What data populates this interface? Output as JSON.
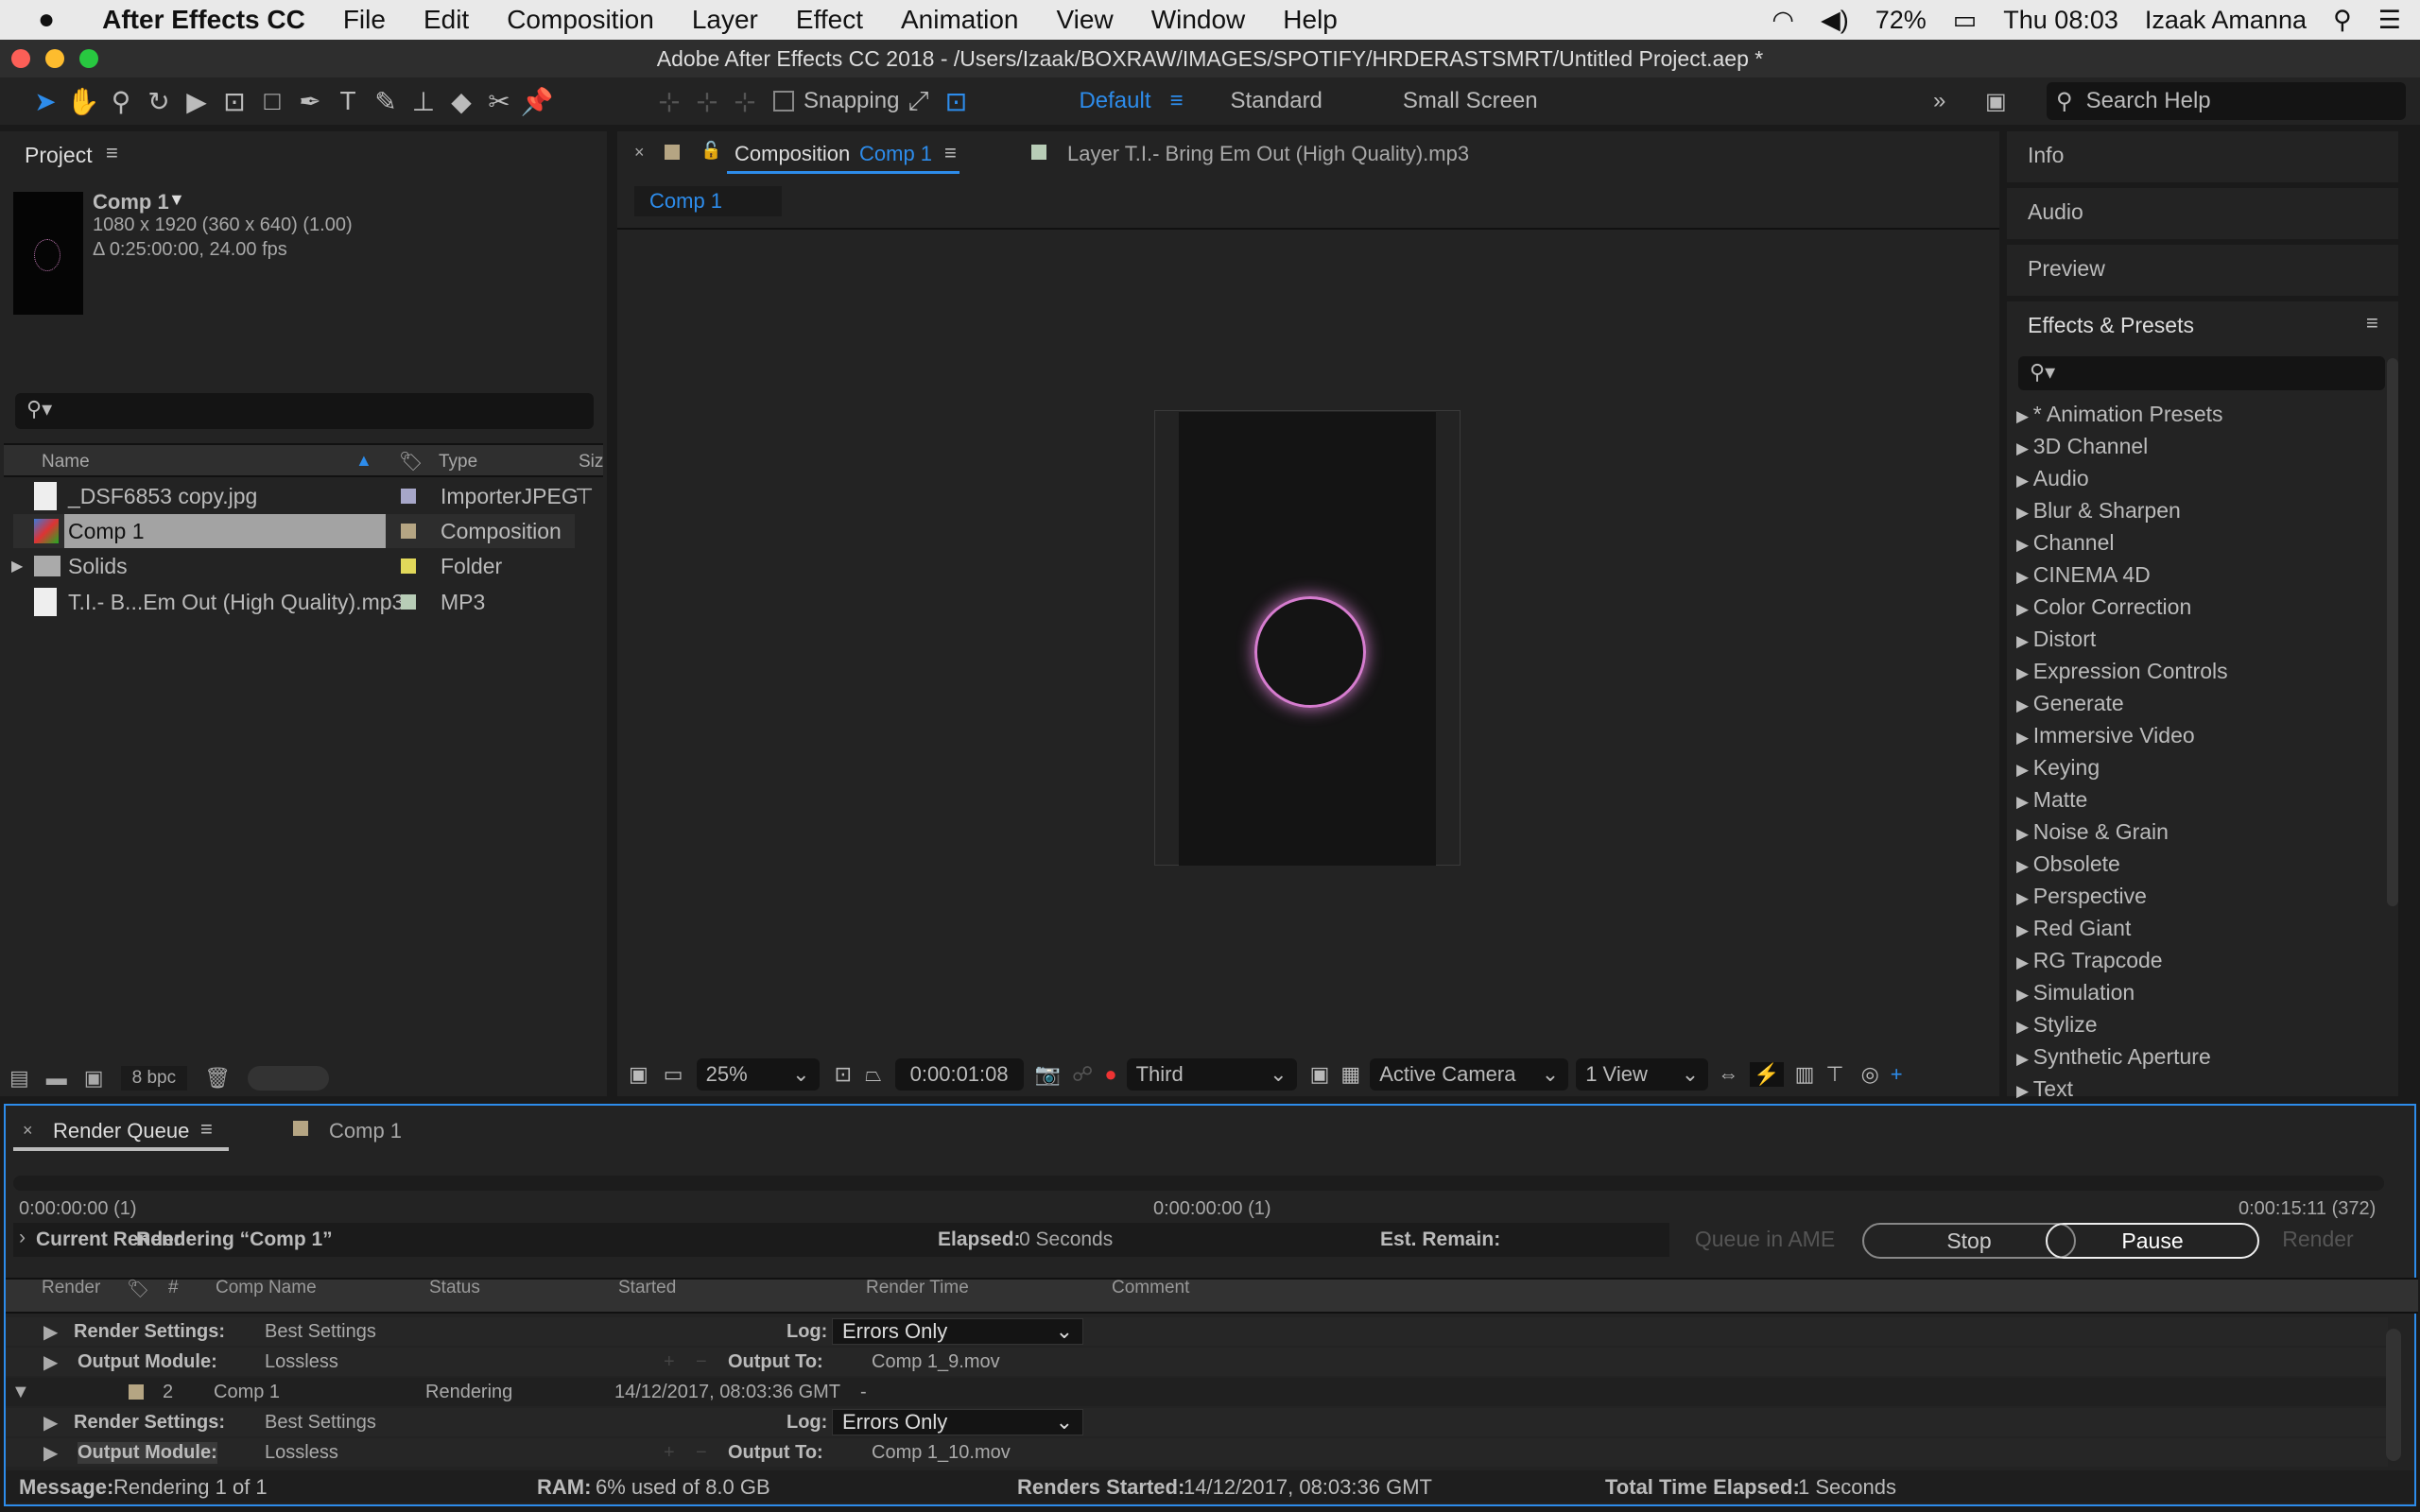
{
  "menubar": {
    "app": "After Effects CC",
    "items": [
      "File",
      "Edit",
      "Composition",
      "Layer",
      "Effect",
      "Animation",
      "View",
      "Window",
      "Help"
    ],
    "battery": "72%",
    "clock": "Thu 08:03",
    "user": "Izaak Amanna"
  },
  "window_title": "Adobe After Effects CC 2018 - /Users/Izaak/BOXRAW/IMAGES/SPOTIFY/HRDERASTSMRT/Untitled Project.aep *",
  "toolbar": {
    "snapping": "Snapping",
    "workspaces": [
      "Default",
      "Standard",
      "Small Screen"
    ],
    "active_workspace": "Default",
    "search_placeholder": "Search Help"
  },
  "project": {
    "title": "Project",
    "comp_name": "Comp 1",
    "comp_size": "1080 x 1920  (360 x 640) (1.00)",
    "comp_duration": "Δ 0:25:00:00, 24.00 fps",
    "columns": {
      "name": "Name",
      "type": "Type",
      "size": "Siz"
    },
    "items": [
      {
        "name": "_DSF6853 copy.jpg",
        "type": "ImporterJPEG",
        "color": "#a7a7c9",
        "icon": "jpeg-file-icon"
      },
      {
        "name": "Comp 1",
        "type": "Composition",
        "color": "#b5a583",
        "icon": "composition-icon",
        "selected": true
      },
      {
        "name": "Solids",
        "type": "Folder",
        "color": "#e1d85a",
        "icon": "folder-icon"
      },
      {
        "name": "T.I.- B...Em Out (High Quality).mp3",
        "type": "MP3",
        "color": "#b8cdb7",
        "icon": "mp3-file-icon"
      }
    ],
    "bpc": "8 bpc"
  },
  "viewer": {
    "tab_prefix": "Composition",
    "tab_comp": "Comp 1",
    "layer_tab": "Layer T.I.- Bring Em Out (High Quality).mp3",
    "breadcrumb": "Comp 1",
    "zoom": "25%",
    "timecode": "0:00:01:08",
    "resolution": "Third",
    "camera": "Active Camera",
    "views": "1 View"
  },
  "right_panels": {
    "info": "Info",
    "audio": "Audio",
    "preview": "Preview",
    "effects_title": "Effects & Presets",
    "effects": [
      "* Animation Presets",
      "3D Channel",
      "Audio",
      "Blur & Sharpen",
      "Channel",
      "CINEMA 4D",
      "Color Correction",
      "Distort",
      "Expression Controls",
      "Generate",
      "Immersive Video",
      "Keying",
      "Matte",
      "Noise & Grain",
      "Obsolete",
      "Perspective",
      "Red Giant",
      "RG Trapcode",
      "Simulation",
      "Stylize",
      "Synthetic Aperture",
      "Text"
    ]
  },
  "render_queue": {
    "tab": "Render Queue",
    "comp_tab": "Comp 1",
    "time_start": "0:00:00:00 (1)",
    "time_mid": "0:00:00:00 (1)",
    "time_end": "0:00:15:11 (372)",
    "progress": 0,
    "current_render_label": "Current Render",
    "rendering": "Rendering “Comp 1”",
    "elapsed_label": "Elapsed:",
    "elapsed": "0 Seconds",
    "remain_label": "Est. Remain:",
    "buttons": {
      "ame": "Queue in AME",
      "stop": "Stop",
      "pause": "Pause",
      "render": "Render"
    },
    "columns": [
      "Render",
      "#",
      "Comp Name",
      "Status",
      "Started",
      "Render Time",
      "Comment"
    ],
    "items": [
      {
        "render_settings": "Best Settings",
        "log": "Errors Only",
        "output_module": "Lossless",
        "output_to": "Comp 1_9.mov"
      },
      {
        "num": "2",
        "comp": "Comp 1",
        "status": "Rendering",
        "started": "14/12/2017, 08:03:36 GMT",
        "render_time": "-",
        "render_settings": "Best Settings",
        "log": "Errors Only",
        "output_module": "Lossless",
        "output_to": "Comp 1_10.mov"
      }
    ],
    "labels": {
      "render_settings": "Render Settings:",
      "output_module": "Output Module:",
      "log": "Log:",
      "output_to": "Output To:"
    },
    "status_bar": {
      "message_label": "Message:",
      "message": "Rendering 1 of 1",
      "ram_label": "RAM:",
      "ram": "6% used of 8.0 GB",
      "started_label": "Renders Started:",
      "started": "14/12/2017, 08:03:36 GMT",
      "total_label": "Total Time Elapsed:",
      "total": "1 Seconds"
    }
  },
  "colors": {
    "accent": "#2d8ceb",
    "comp_label": "#b5a583"
  }
}
